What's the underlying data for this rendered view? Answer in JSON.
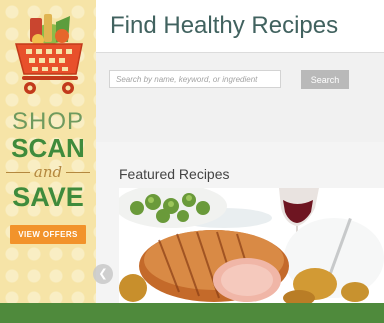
{
  "promo": {
    "line1": "SHOP",
    "line2": "SCAN",
    "connector": "and",
    "line3": "SAVE",
    "button_label": "VIEW OFFERS",
    "cart_icon": "shopping-cart-with-groceries-icon",
    "colors": {
      "background": "#f6e4a7",
      "green": "#3f8b3c",
      "light_green": "#6f9a5e",
      "gold": "#b4883f",
      "button": "#f2932b"
    }
  },
  "header": {
    "title": "Find Healthy Recipes",
    "title_color": "#41625f"
  },
  "search": {
    "placeholder": "Search by name, keyword, or ingredient",
    "value": "",
    "button_label": "Search"
  },
  "featured": {
    "title": "Featured Recipes",
    "prev_icon": "chevron-left-icon"
  },
  "footer": {
    "color": "#4f8a3c"
  }
}
